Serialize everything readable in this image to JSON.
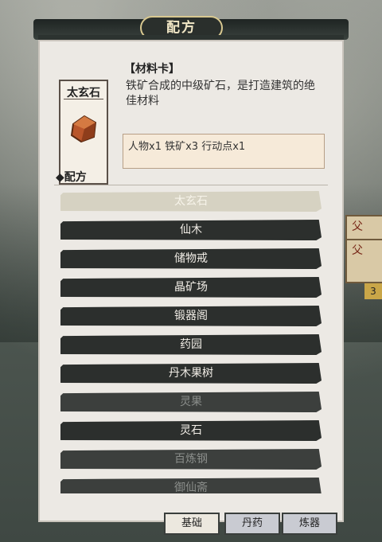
{
  "header": {
    "title": "配方"
  },
  "item": {
    "name": "太玄石",
    "category": "【材料卡】",
    "description": "铁矿合成的中级矿石，是打造建筑的绝佳材料",
    "cost": "人物x1 铁矿x3 行动点x1"
  },
  "recipes_label": "◆配方",
  "recipes": [
    {
      "label": "太玄石",
      "state": "selected"
    },
    {
      "label": "仙木",
      "state": "available"
    },
    {
      "label": "储物戒",
      "state": "available"
    },
    {
      "label": "晶矿场",
      "state": "available"
    },
    {
      "label": "锻器阁",
      "state": "available"
    },
    {
      "label": "药园",
      "state": "available"
    },
    {
      "label": "丹木果树",
      "state": "available"
    },
    {
      "label": "灵果",
      "state": "locked"
    },
    {
      "label": "灵石",
      "state": "available"
    },
    {
      "label": "百炼钢",
      "state": "locked"
    },
    {
      "label": "御仙斋",
      "state": "locked"
    }
  ],
  "tabs": [
    {
      "label": "基础",
      "active": false
    },
    {
      "label": "丹药",
      "active": true
    },
    {
      "label": "炼器",
      "active": true
    }
  ],
  "side": {
    "card_char_1": "父",
    "card_char_2": "父",
    "badge": "3"
  },
  "colors": {
    "bar": "#2c2f2d",
    "selected_bar": "#d6d2c2",
    "panel": "#ece9e4"
  }
}
